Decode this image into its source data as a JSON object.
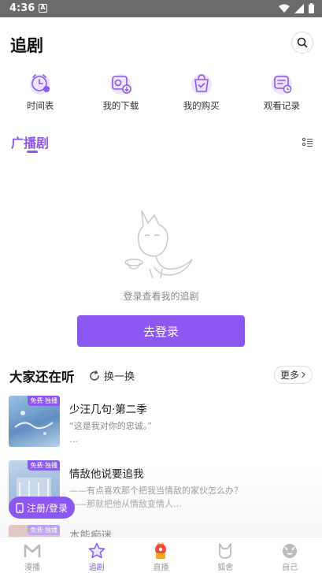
{
  "status_bar": {
    "time": "4:36",
    "notif_letter": "A"
  },
  "header": {
    "title": "追剧"
  },
  "quick_actions": [
    {
      "label": "时间表",
      "icon": "alarm-clock-icon"
    },
    {
      "label": "我的下载",
      "icon": "download-icon"
    },
    {
      "label": "我的购买",
      "icon": "purchase-bag-icon"
    },
    {
      "label": "观看记录",
      "icon": "history-icon"
    }
  ],
  "section": {
    "tab_label": "广播剧"
  },
  "empty_state": {
    "message": "登录查看我的追剧",
    "login_button": "去登录"
  },
  "recommend": {
    "title": "大家还在听",
    "refresh_label": "换一换",
    "more_label": "更多",
    "items": [
      {
        "badge": "免费·独播",
        "name": "少汪几句·第二季",
        "desc": "“这是我对你的忠诚。”\n…",
        "cover_color": "#7fb0d6"
      },
      {
        "badge": "免费·独播",
        "name": "情敌他说要追我",
        "desc": "——有点喜欢那个把我当情敌的家伙怎么办？\n——那就把他从情敌变情人…",
        "cover_color": "#9bb6da"
      },
      {
        "badge": "免费·独播",
        "name": "本能痴迷",
        "desc": "",
        "cover_color": "#c99a8a"
      }
    ]
  },
  "register_button": "注册/登录",
  "tabbar": [
    {
      "label": "漫播",
      "icon": "manbo-logo-icon",
      "active": false
    },
    {
      "label": "追剧",
      "icon": "star-icon",
      "active": true
    },
    {
      "label": "直播",
      "icon": "live-broadcast-icon",
      "active": false
    },
    {
      "label": "狐舍",
      "icon": "fox-house-icon",
      "active": false
    },
    {
      "label": "自己",
      "icon": "profile-avatar-icon",
      "active": false
    }
  ],
  "colors": {
    "accent": "#8c57f0",
    "status_bar": "#6b6b6b"
  }
}
